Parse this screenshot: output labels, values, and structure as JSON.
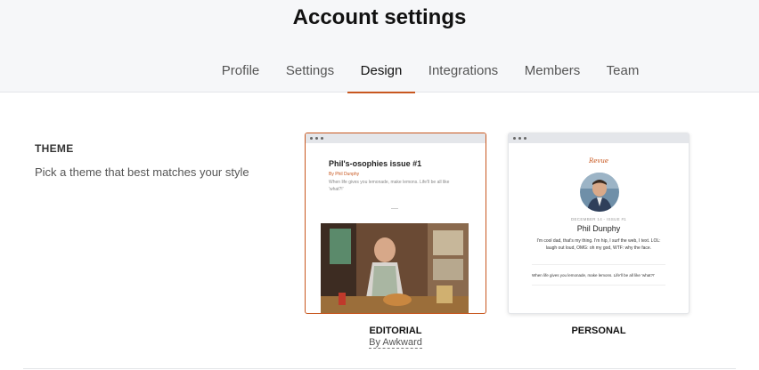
{
  "header": {
    "title": "Account settings",
    "tabs": [
      {
        "label": "Profile",
        "active": false
      },
      {
        "label": "Settings",
        "active": false
      },
      {
        "label": "Design",
        "active": true
      },
      {
        "label": "Integrations",
        "active": false
      },
      {
        "label": "Members",
        "active": false
      },
      {
        "label": "Team",
        "active": false
      }
    ]
  },
  "theme": {
    "label": "THEME",
    "description": "Pick a theme that best matches your style",
    "cards": [
      {
        "name": "EDITORIAL",
        "byline": "By Awkward",
        "selected": true,
        "preview": {
          "title": "Phil's-osophies issue #1",
          "author": "By Phil Dunphy",
          "text": "When life gives you lemonade, make lemons. Life'll be all like 'what?!'"
        }
      },
      {
        "name": "PERSONAL",
        "selected": false,
        "preview": {
          "logo": "Revue",
          "date": "DECEMBER 14 - ISSUE #1",
          "name": "Phil Dunphy",
          "bio": "I'm cool dad, that's my thing. I'm hip, I surf the web, I text. LOL: laugh out loud, OMG: oh my god, WTF: why the face.",
          "quote": "When life gives you lemonade, make lemons. Life'll be all like 'what?!'"
        }
      }
    ]
  },
  "colors": {
    "accent": "#c8571f",
    "header_bg": "#f6f7f9"
  }
}
